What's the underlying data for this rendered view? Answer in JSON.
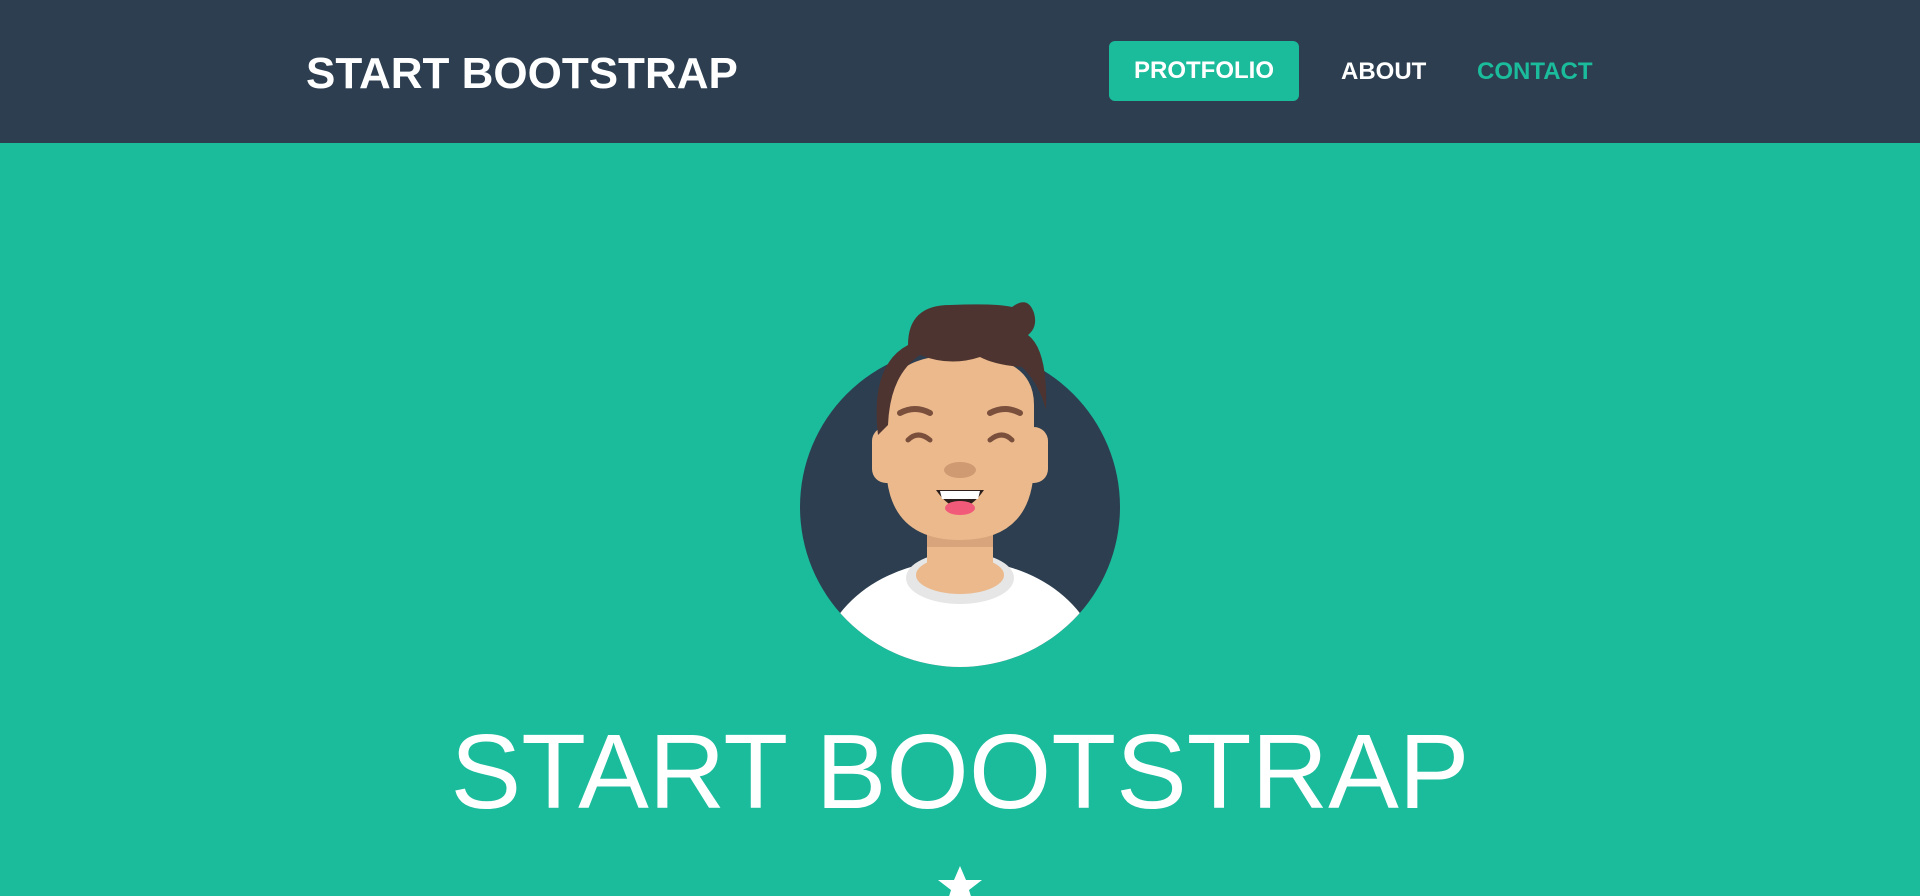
{
  "navbar": {
    "brand": "START BOOTSTRAP",
    "links": [
      {
        "label": "PROTFOLIO",
        "active": true
      },
      {
        "label": "ABOUT",
        "active": false
      },
      {
        "label": "CONTACT",
        "active": false
      }
    ]
  },
  "masthead": {
    "heading": "START BOOTSTRAP",
    "avatar_icon": "avatar-illustration",
    "divider_icon": "star-icon"
  },
  "colors": {
    "navbar_bg": "#2c3e50",
    "primary": "#1abc9c",
    "text_light": "#ffffff"
  }
}
